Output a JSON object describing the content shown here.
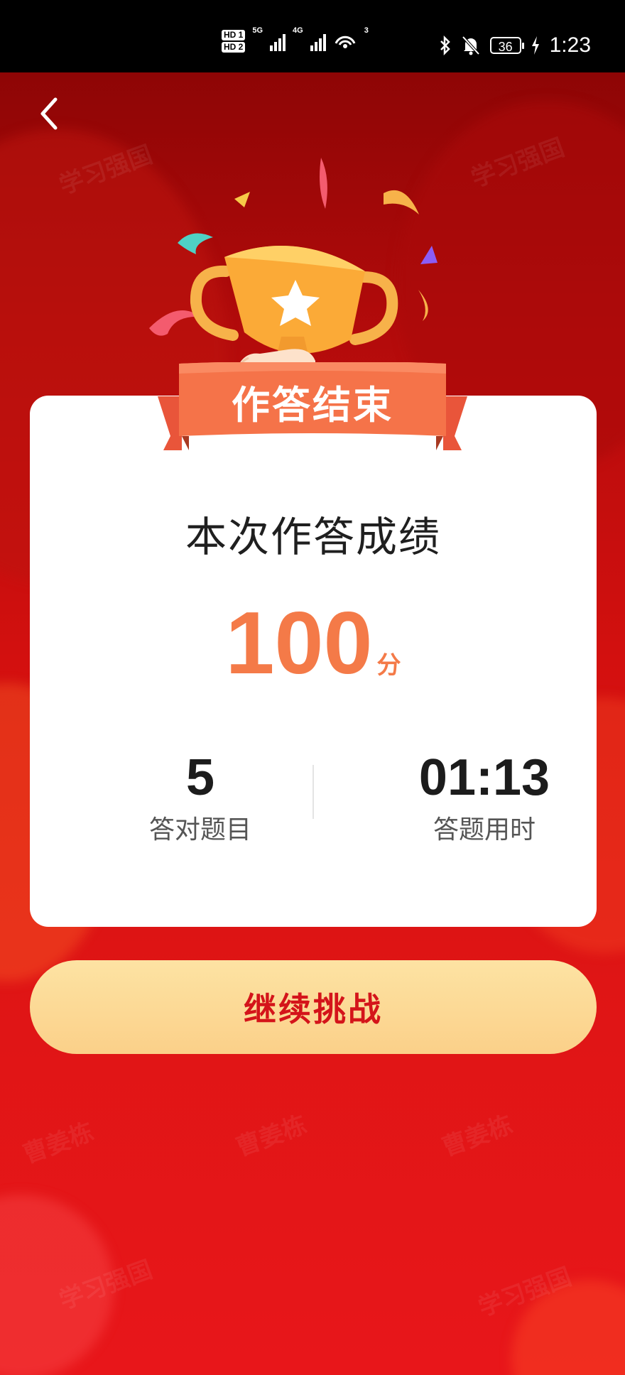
{
  "status_bar": {
    "hd1": "HD 1",
    "hd2": "HD 2",
    "net1": "5G",
    "net2": "4G",
    "wifi_count": "3",
    "battery": "36",
    "time": "1:23"
  },
  "header": {
    "back_icon": "chevron-left-icon"
  },
  "watermarks": [
    "学习强国",
    "学习强国",
    "曹姜栋",
    "曹姜栋",
    "曹姜栋",
    "学习强国",
    "学习强国"
  ],
  "banner": {
    "title": "作答结束"
  },
  "result_card": {
    "title": "本次作答成绩",
    "score": "100",
    "score_unit": "分",
    "stats": [
      {
        "value": "5",
        "label": "答对题目"
      },
      {
        "value": "01:13",
        "label": "答题用时"
      }
    ]
  },
  "continue_button": {
    "label": "继续挑战"
  },
  "colors": {
    "accent": "#f47a48",
    "button_text": "#d4141a",
    "button_bg": "#fbd089",
    "background": "#d3100f"
  }
}
